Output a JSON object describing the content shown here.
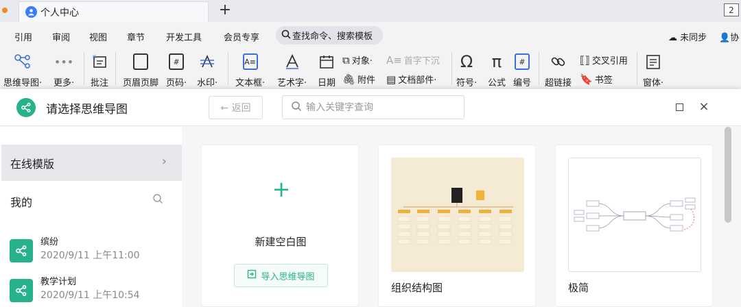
{
  "tabbar": {
    "tab_title": "个人中心",
    "tab_icon": "user-icon",
    "add_icon": "+",
    "count": "2"
  },
  "menu": {
    "items": [
      "引用",
      "审阅",
      "视图",
      "章节",
      "开发工具",
      "会员专享"
    ],
    "search_label": "查找命令、搜索模板",
    "sync_label": "未同步",
    "collab_label": "协"
  },
  "ribbon": {
    "mindmap": "思维导图·",
    "more": "更多·",
    "comment": "批注",
    "header_footer": "页眉页脚",
    "page_number": "页码·",
    "watermark": "水印·",
    "textbox": "文本框·",
    "wordart": "艺术字·",
    "date": "日期",
    "object": "对象·",
    "attachment": "附件",
    "dropcap": "首字下沉",
    "doc_parts": "文档部件·",
    "symbol": "符号·",
    "formula": "公式",
    "numbering": "编号",
    "hyperlink": "超链接",
    "cross_ref": "交叉引用",
    "bookmark": "书签",
    "window": "窗体·"
  },
  "dialog": {
    "title": "请选择思维导图",
    "back_label": "← 返回",
    "search_placeholder": "输入关键字查询",
    "close_icon": "×"
  },
  "sidebar": {
    "online": "在线模版",
    "mine": "我的",
    "files": [
      {
        "name": "缤纷",
        "date": "2020/9/11 上午11:00"
      },
      {
        "name": "教学计划",
        "date": "2020/9/11 上午10:54"
      }
    ]
  },
  "cards": {
    "blank_label": "新建空白图",
    "import_label": "导入思维导图",
    "org_label": "组织结构图",
    "min_label": "极简"
  },
  "colors": {
    "accent": "#28b28c",
    "tab_icon": "#3b7cff",
    "record_dot": "#f28b26"
  }
}
